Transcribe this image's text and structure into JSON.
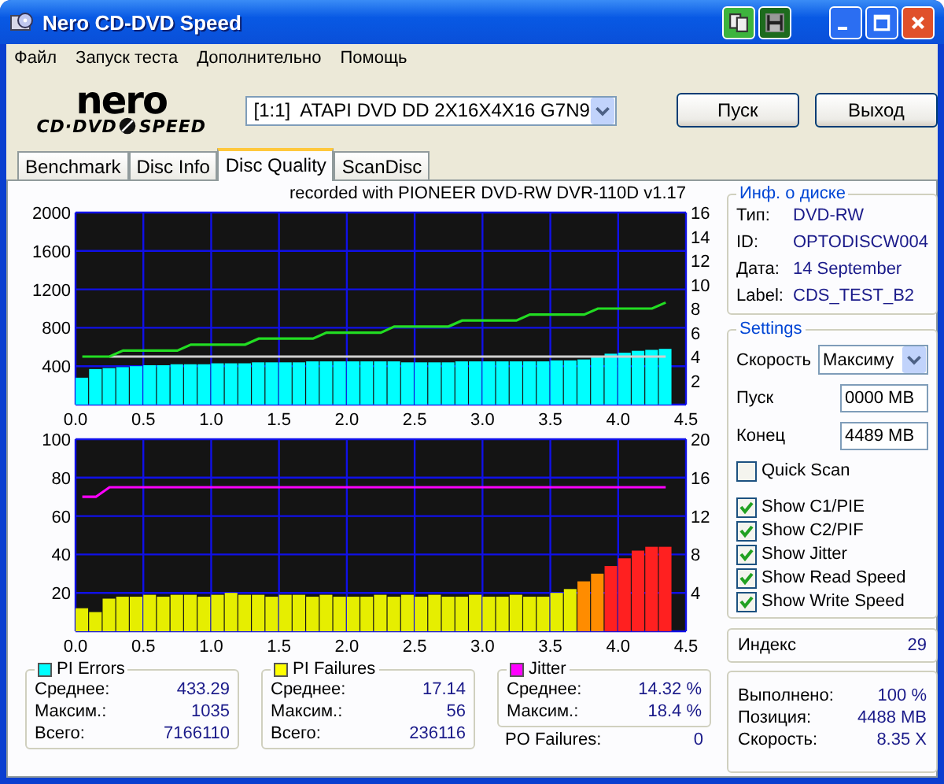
{
  "window": {
    "title": "Nero CD-DVD Speed"
  },
  "menu": [
    "Файл",
    "Запуск теста",
    "Дополнительно",
    "Помощь"
  ],
  "logo": {
    "wordmark": "nero",
    "left": "CD·DVD",
    "right": "SPEED"
  },
  "drive": "[1:1]  ATAPI DVD DD 2X16X4X16 G7N9",
  "buttons": [
    "Пуск",
    "Выход"
  ],
  "tabs": [
    {
      "label": "Benchmark",
      "selected": false
    },
    {
      "label": "Disc Info",
      "selected": false
    },
    {
      "label": "Disc Quality",
      "selected": true
    },
    {
      "label": "ScanDisc",
      "selected": false
    }
  ],
  "recorder_note": "recorded with PIONEER DVD-RW  DVR-110D v1.17",
  "charts": [
    {
      "chart_data": {
        "type": "bar",
        "grid": true,
        "xlim": [
          0,
          4.5
        ],
        "ylim": [
          0,
          2000
        ],
        "y2lim": [
          0,
          16
        ],
        "xticks": [
          {
            "value": 0,
            "label": "0.0"
          },
          {
            "value": 0.5,
            "label": "0.5"
          },
          {
            "value": 1,
            "label": "1.0"
          },
          {
            "value": 1.5,
            "label": "1.5"
          },
          {
            "value": 2,
            "label": "2.0"
          },
          {
            "value": 2.5,
            "label": "2.5"
          },
          {
            "value": 3,
            "label": "3.0"
          },
          {
            "value": 3.5,
            "label": "3.5"
          },
          {
            "value": 4,
            "label": "4.0"
          },
          {
            "value": 4.5,
            "label": "4.5"
          }
        ],
        "yticks": [
          400,
          800,
          1200,
          1600,
          2000
        ],
        "y2ticks": [
          2,
          4,
          6,
          8,
          10,
          12,
          14,
          16
        ],
        "x": [
          0.05,
          0.15,
          0.25,
          0.35,
          0.45,
          0.55,
          0.65,
          0.75,
          0.85,
          0.95,
          1.05,
          1.15,
          1.25,
          1.35,
          1.45,
          1.55,
          1.65,
          1.75,
          1.85,
          1.95,
          2.05,
          2.15,
          2.25,
          2.35,
          2.45,
          2.55,
          2.65,
          2.75,
          2.85,
          2.95,
          3.05,
          3.15,
          3.25,
          3.35,
          3.45,
          3.55,
          3.65,
          3.75,
          3.85,
          3.95,
          4.05,
          4.15,
          4.25,
          4.35
        ],
        "series": [
          {
            "type": "bar",
            "color": "#00ffff",
            "values": [
              280,
              370,
              380,
              390,
              400,
              410,
              410,
              420,
              420,
              420,
              430,
              430,
              430,
              440,
              440,
              440,
              440,
              450,
              450,
              450,
              450,
              450,
              450,
              450,
              440,
              440,
              440,
              440,
              450,
              450,
              450,
              450,
              450,
              450,
              450,
              460,
              460,
              470,
              500,
              530,
              540,
              560,
              570,
              580
            ]
          },
          {
            "type": "line",
            "axis": "y2",
            "color": "#d0d0d0",
            "values": [
              null,
              null,
              4,
              4,
              4,
              4,
              4,
              4,
              4,
              4,
              4,
              4,
              4,
              4,
              4,
              4,
              4,
              4,
              4,
              4,
              4,
              4,
              4,
              4,
              4,
              4,
              4,
              4,
              4,
              4,
              4,
              4,
              4,
              4,
              4,
              4,
              4,
              4,
              4,
              4,
              4,
              4,
              4,
              4
            ]
          },
          {
            "type": "line",
            "axis": "y2",
            "color": "#22dd22",
            "values": [
              4,
              4,
              4,
              4.5,
              4.5,
              4.5,
              4.5,
              4.5,
              5,
              5,
              5,
              5,
              5,
              5.5,
              5.5,
              5.5,
              5.5,
              5.5,
              6,
              6,
              6,
              6,
              6,
              6.5,
              6.5,
              6.5,
              6.5,
              6.5,
              7,
              7,
              7,
              7,
              7,
              7.5,
              7.5,
              7.5,
              7.5,
              7.5,
              8,
              8,
              8,
              8,
              8,
              8.5
            ]
          }
        ]
      }
    },
    {
      "chart_data": {
        "type": "bar",
        "grid": true,
        "xlim": [
          0,
          4.5
        ],
        "ylim": [
          0,
          100
        ],
        "y2lim": [
          0,
          20
        ],
        "xticks": [
          {
            "value": 0,
            "label": "0.0"
          },
          {
            "value": 0.5,
            "label": "0.5"
          },
          {
            "value": 1,
            "label": "1.0"
          },
          {
            "value": 1.5,
            "label": "1.5"
          },
          {
            "value": 2,
            "label": "2.0"
          },
          {
            "value": 2.5,
            "label": "2.5"
          },
          {
            "value": 3,
            "label": "3.0"
          },
          {
            "value": 3.5,
            "label": "3.5"
          },
          {
            "value": 4,
            "label": "4.0"
          },
          {
            "value": 4.5,
            "label": "4.5"
          }
        ],
        "yticks": [
          20,
          40,
          60,
          80,
          100
        ],
        "y2ticks": [
          4,
          8,
          12,
          16,
          20
        ],
        "x": [
          0.05,
          0.15,
          0.25,
          0.35,
          0.45,
          0.55,
          0.65,
          0.75,
          0.85,
          0.95,
          1.05,
          1.15,
          1.25,
          1.35,
          1.45,
          1.55,
          1.65,
          1.75,
          1.85,
          1.95,
          2.05,
          2.15,
          2.25,
          2.35,
          2.45,
          2.55,
          2.65,
          2.75,
          2.85,
          2.95,
          3.05,
          3.15,
          3.25,
          3.35,
          3.45,
          3.55,
          3.65,
          3.75,
          3.85,
          3.95,
          4.05,
          4.15,
          4.25,
          4.35
        ],
        "series": [
          {
            "type": "bar",
            "color": "#e6ee00",
            "values": [
              12,
              10,
              17,
              18,
              18,
              19,
              18,
              19,
              19,
              18,
              19,
              20,
              19,
              19,
              18,
              19,
              19,
              18,
              19,
              18,
              18,
              18,
              19,
              18,
              19,
              18,
              19,
              18,
              18,
              19,
              18,
              18,
              19,
              18,
              18,
              20,
              22,
              null,
              null,
              null,
              null,
              null,
              null,
              null
            ]
          },
          {
            "type": "bar",
            "color": "#ff8c00",
            "values": [
              null,
              null,
              null,
              null,
              null,
              null,
              null,
              null,
              null,
              null,
              null,
              null,
              null,
              null,
              null,
              null,
              null,
              null,
              null,
              null,
              null,
              null,
              null,
              null,
              null,
              null,
              null,
              null,
              null,
              null,
              null,
              null,
              null,
              null,
              null,
              null,
              null,
              26,
              30,
              null,
              null,
              null,
              null,
              null
            ]
          },
          {
            "type": "bar",
            "color": "#ff2020",
            "values": [
              null,
              null,
              null,
              null,
              null,
              null,
              null,
              null,
              null,
              null,
              null,
              null,
              null,
              null,
              null,
              null,
              null,
              null,
              null,
              null,
              null,
              null,
              null,
              null,
              null,
              null,
              null,
              null,
              null,
              null,
              null,
              null,
              null,
              null,
              null,
              null,
              null,
              null,
              null,
              34,
              38,
              42,
              44,
              44
            ]
          },
          {
            "type": "line",
            "axis": "y2",
            "color": "#ff00ff",
            "values": [
              14,
              14,
              15,
              15,
              15,
              15,
              15,
              15,
              15,
              15,
              15,
              15,
              15,
              15,
              15,
              15,
              15,
              15,
              15,
              15,
              15,
              15,
              15,
              15,
              15,
              15,
              15,
              15,
              15,
              15,
              15,
              15,
              15,
              15,
              15,
              15,
              15,
              15,
              15,
              15,
              15,
              15,
              15,
              15
            ]
          }
        ]
      }
    }
  ],
  "stats": [
    {
      "title": "PI Errors",
      "color": "#00ffff",
      "rows": [
        {
          "label": "Среднее:",
          "value": "433.29"
        },
        {
          "label": "Максим.:",
          "value": "1035"
        },
        {
          "label": "Всего:",
          "value": "7166110"
        }
      ]
    },
    {
      "title": "PI Failures",
      "color": "#ffff00",
      "rows": [
        {
          "label": "Среднее:",
          "value": "17.14"
        },
        {
          "label": "Максим.:",
          "value": "56"
        },
        {
          "label": "Всего:",
          "value": "236116"
        }
      ]
    },
    {
      "title": "Jitter",
      "color": "#ff00ff",
      "rows": [
        {
          "label": "Среднее:",
          "value": "14.32 %"
        },
        {
          "label": "Максим.:",
          "value": "18.4 %"
        }
      ]
    }
  ],
  "po_failures": {
    "label": "PO Failures:",
    "value": "0"
  },
  "disc_info": {
    "title": "Инф. о диске",
    "rows": [
      {
        "label": "Тип:",
        "value": "DVD-RW"
      },
      {
        "label": "ID:",
        "value": "OPTODISCW004"
      },
      {
        "label": "Дата:",
        "value": "14 September"
      },
      {
        "label": "Label:",
        "value": "CDS_TEST_B2"
      }
    ]
  },
  "settings": {
    "title": "Settings",
    "speed_label": "Скорость",
    "speed": "Максиму",
    "start_label": "Пуск",
    "start": "0000 MB",
    "end_label": "Конец",
    "end": "4489 MB",
    "quick_scan": {
      "label": "Quick Scan",
      "checked": false
    },
    "options": [
      {
        "label": "Show C1/PIE",
        "checked": true
      },
      {
        "label": "Show C2/PIF",
        "checked": true
      },
      {
        "label": "Show Jitter",
        "checked": true
      },
      {
        "label": "Show Read Speed",
        "checked": true
      },
      {
        "label": "Show Write Speed",
        "checked": true
      }
    ]
  },
  "index": {
    "label": "Индекс",
    "value": "29"
  },
  "progress": [
    {
      "label": "Выполнено:",
      "value": "100 %"
    },
    {
      "label": "Позиция:",
      "value": "4488 MB"
    },
    {
      "label": "Скорость:",
      "value": "8.35 X"
    }
  ]
}
